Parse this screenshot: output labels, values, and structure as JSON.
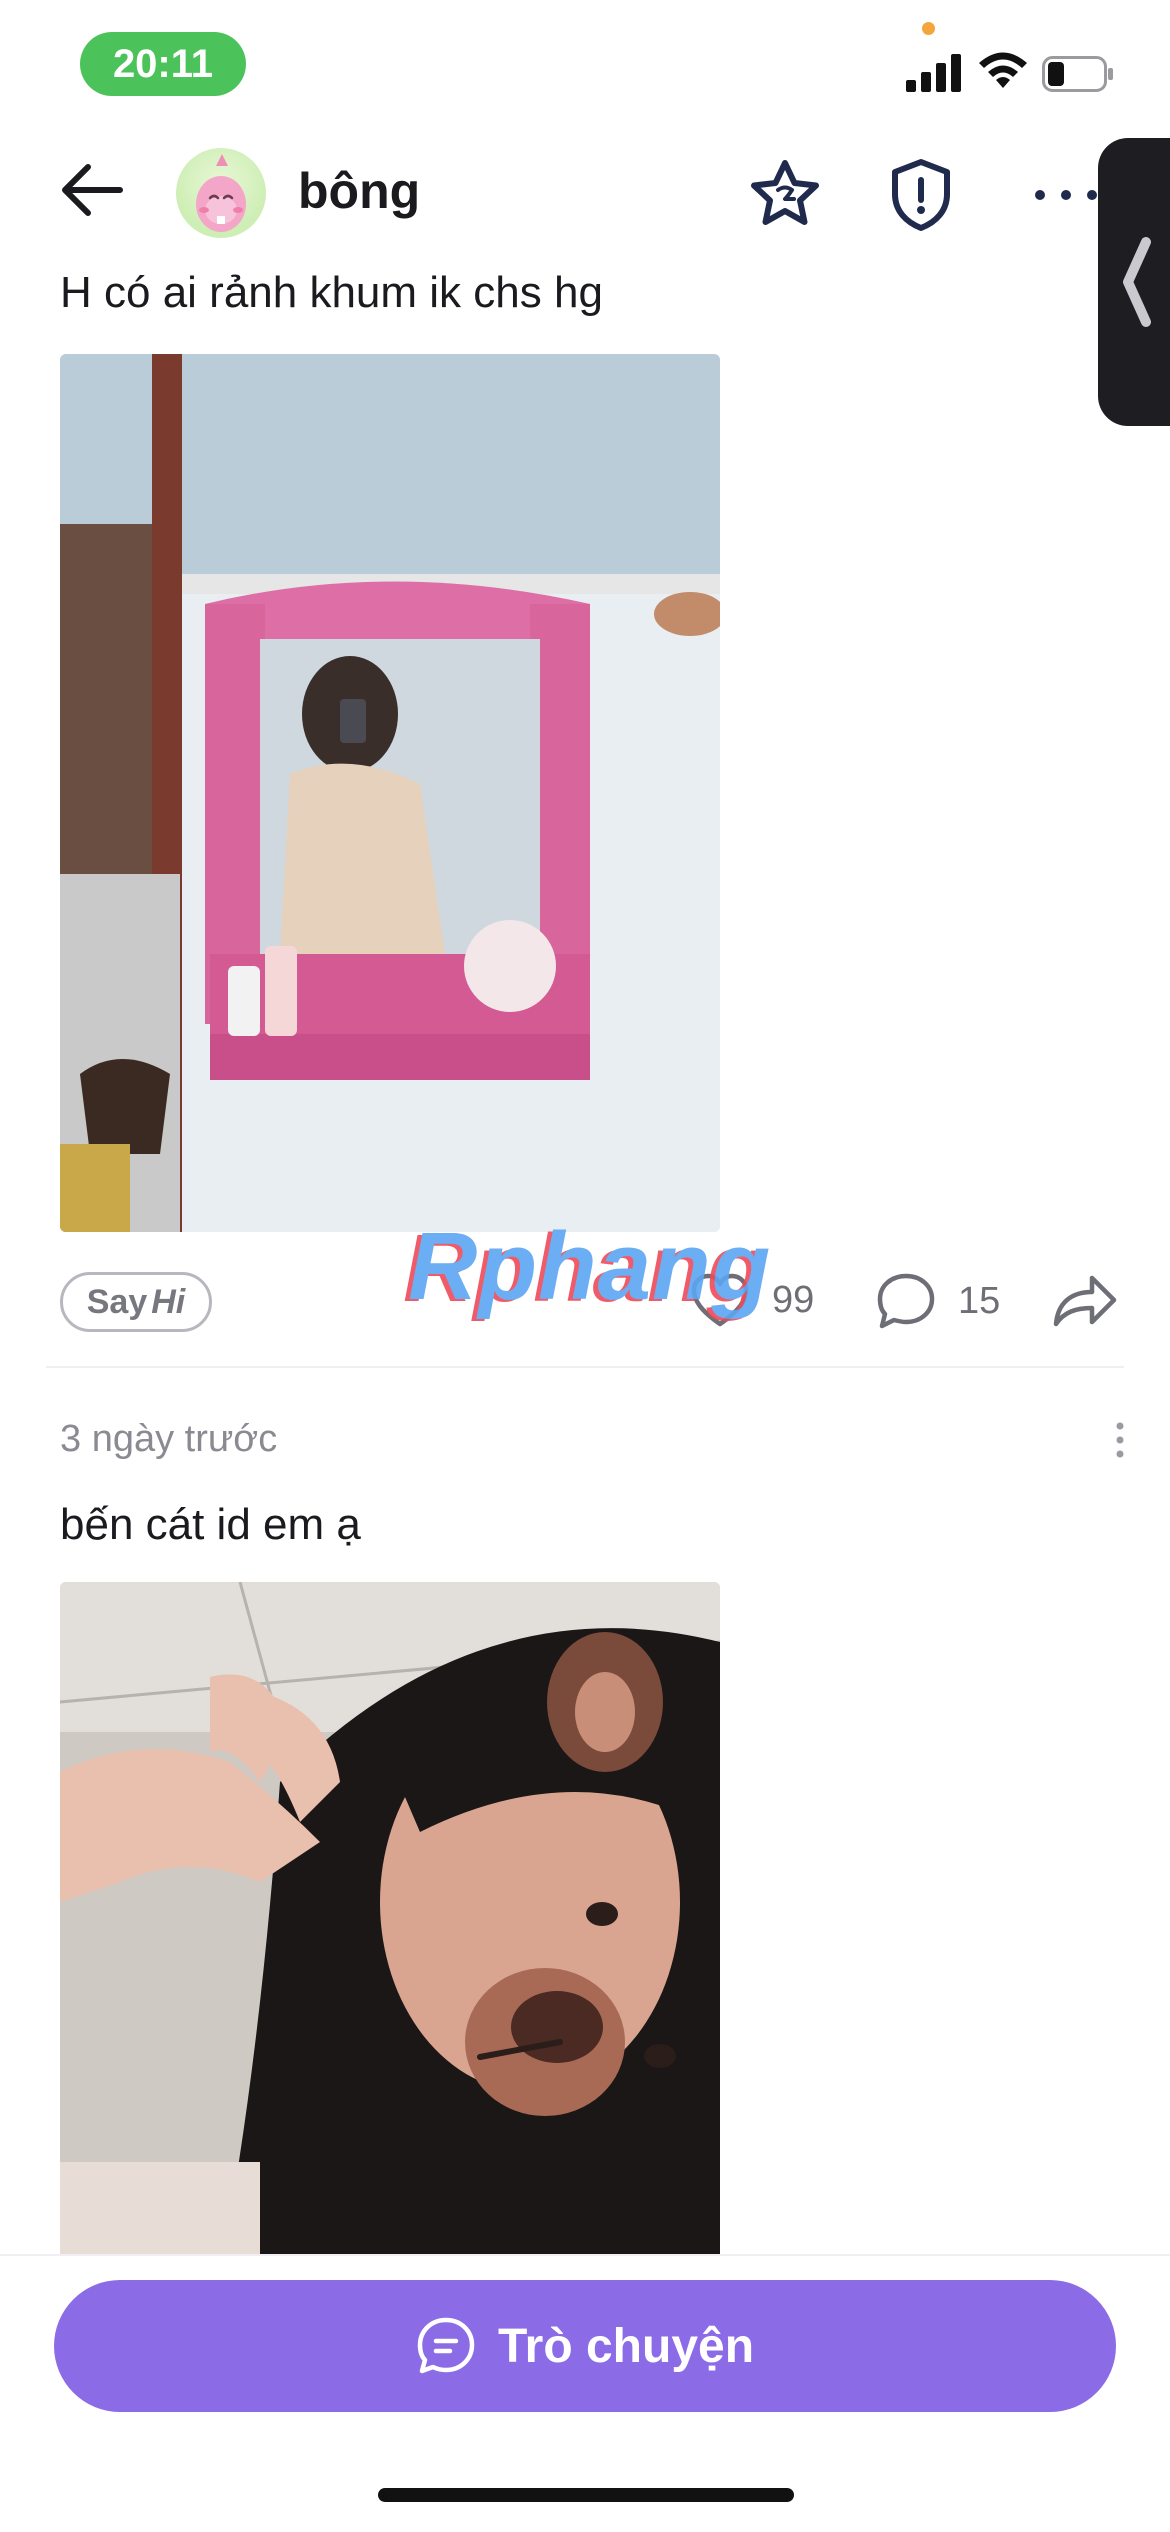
{
  "status_bar": {
    "time": "20:11"
  },
  "header": {
    "username": "bông"
  },
  "posts": [
    {
      "text": "H có ai rảnh khum  ik chs hg",
      "likes": "99",
      "comments": "15"
    },
    {
      "timestamp": "3 ngày trước",
      "text": "bến cát  id em ạ"
    }
  ],
  "sayhi": {
    "say": "Say",
    "hi": "Hi"
  },
  "watermark": "Rphang",
  "bottom": {
    "chat_label": "Trò chuyện"
  },
  "colors": {
    "accent": "#8c6be6",
    "time_pill": "#4cc35a"
  }
}
